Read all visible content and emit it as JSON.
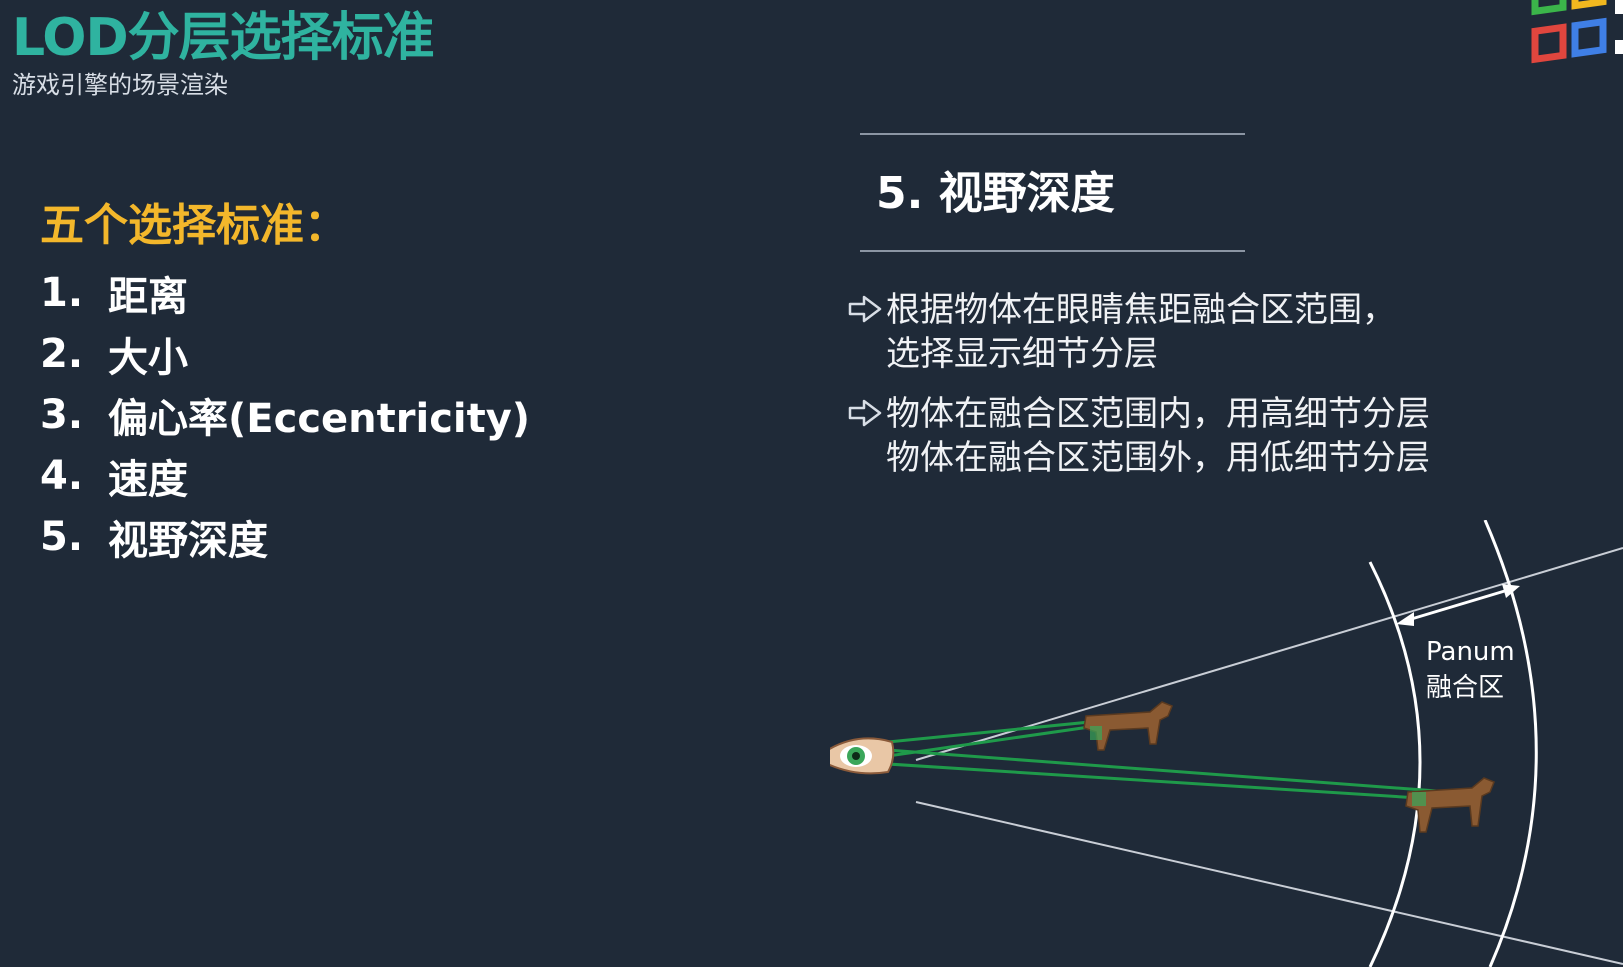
{
  "header": {
    "title": "LOD分层选择标准",
    "subtitle": "游戏引擎的场景渲染"
  },
  "left": {
    "heading": "五个选择标准：",
    "items": [
      {
        "num": "1.",
        "label": "距离"
      },
      {
        "num": "2.",
        "label": "大小"
      },
      {
        "num": "3.",
        "label": "偏心率(Eccentricity)"
      },
      {
        "num": "4.",
        "label": "速度"
      },
      {
        "num": "5.",
        "label": "视野深度"
      }
    ]
  },
  "right": {
    "section_title": "5. 视野深度",
    "bullets": [
      {
        "lines": [
          "根据物体在眼睛焦距融合区范围，",
          "选择显示细节分层"
        ]
      },
      {
        "lines": [
          "物体在融合区范围内，用高细节分层",
          "物体在融合区范围外，用低细节分层"
        ]
      }
    ]
  },
  "diagram": {
    "label_line1": "Panum",
    "label_line2": "融合区"
  },
  "colors": {
    "background": "#1f2a38",
    "title": "#2fb3a0",
    "heading": "#f3b72b",
    "sight_line": "#1f9a4a"
  }
}
